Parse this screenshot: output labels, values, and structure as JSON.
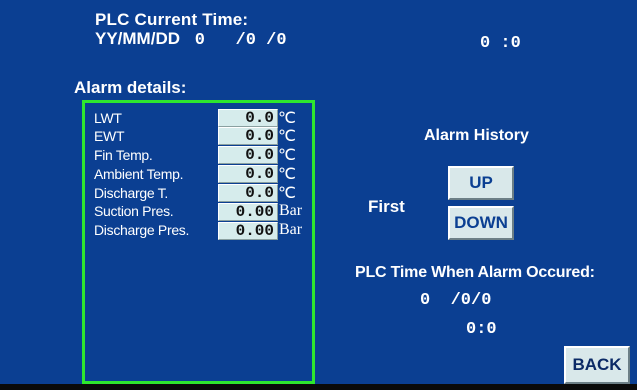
{
  "plc_time": {
    "label": "PLC Current Time:",
    "date_format": "YY/MM/DD",
    "date_value": "0   /0 /0",
    "time_value": "0 :0"
  },
  "alarm_details": {
    "title": "Alarm details:",
    "rows": [
      {
        "label": "LWT",
        "value": "0.0",
        "unit": "℃"
      },
      {
        "label": "EWT",
        "value": "0.0",
        "unit": "℃"
      },
      {
        "label": "Fin Temp.",
        "value": "0.0",
        "unit": "℃"
      },
      {
        "label": "Ambient Temp.",
        "value": "0.0",
        "unit": "℃"
      },
      {
        "label": "Discharge T.",
        "value": "0.0",
        "unit": "℃"
      },
      {
        "label": "Suction Pres.",
        "value": "0.00",
        "unit": "Bar"
      },
      {
        "label": "Discharge Pres.",
        "value": "0.00",
        "unit": "Bar"
      }
    ]
  },
  "alarm_history": {
    "title": "Alarm History",
    "position_label": "First",
    "up_label": "UP",
    "down_label": "DOWN"
  },
  "alarm_time": {
    "label": "PLC Time When Alarm Occured:",
    "date_value": "0  /0/0",
    "time_value": "0:0"
  },
  "back_label": "BACK",
  "colors": {
    "background": "#0b3f92",
    "frame": "#2ee62e",
    "field": "#d6ecec",
    "button": "#d9e8ea"
  }
}
